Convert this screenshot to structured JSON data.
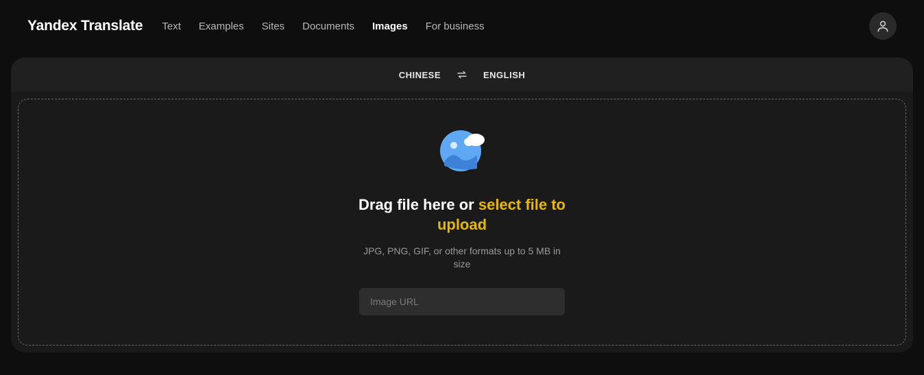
{
  "header": {
    "logo": "Yandex Translate",
    "nav": [
      {
        "label": "Text",
        "active": false
      },
      {
        "label": "Examples",
        "active": false
      },
      {
        "label": "Sites",
        "active": false
      },
      {
        "label": "Documents",
        "active": false
      },
      {
        "label": "Images",
        "active": true
      },
      {
        "label": "For business",
        "active": false
      }
    ]
  },
  "langbar": {
    "source": "CHINESE",
    "target": "ENGLISH"
  },
  "dropzone": {
    "drag_prefix": "Drag file here or ",
    "select_link": "select file to upload",
    "hint": "JPG, PNG, GIF, or other formats up to 5 MB in size",
    "url_placeholder": "Image URL"
  }
}
